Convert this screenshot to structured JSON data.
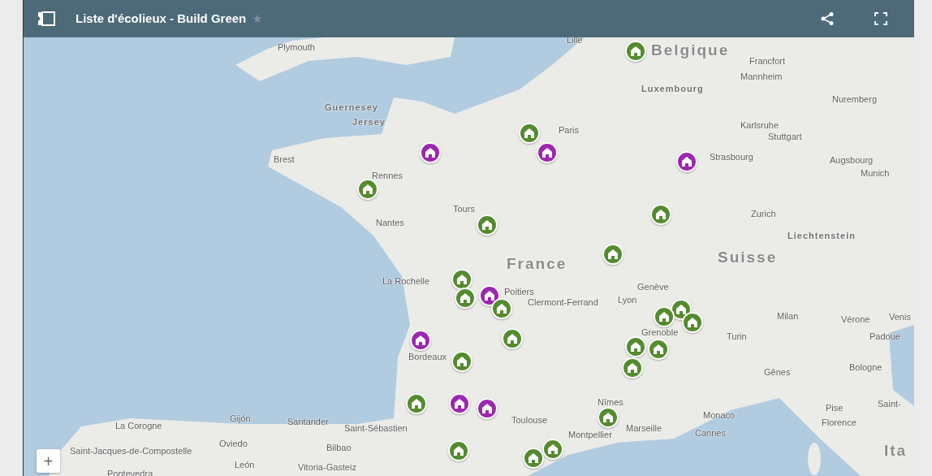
{
  "header": {
    "title": "Liste d'écolieux - Build Green",
    "starred": false
  },
  "map_labels": [
    {
      "text": "Plymouth",
      "kind": "city"
    },
    {
      "text": "Lille",
      "kind": "city"
    },
    {
      "text": "Belgique",
      "kind": "country"
    },
    {
      "text": "Francfort",
      "kind": "city"
    },
    {
      "text": "Luxembourg",
      "kind": "region"
    },
    {
      "text": "Mannheim",
      "kind": "city"
    },
    {
      "text": "Nuremberg",
      "kind": "city"
    },
    {
      "text": "Guernesey",
      "kind": "region"
    },
    {
      "text": "Jersey",
      "kind": "region"
    },
    {
      "text": "Karlsruhe",
      "kind": "city"
    },
    {
      "text": "Paris",
      "kind": "city"
    },
    {
      "text": "Stuttgart",
      "kind": "city"
    },
    {
      "text": "Brest",
      "kind": "city"
    },
    {
      "text": "Strasbourg",
      "kind": "city"
    },
    {
      "text": "Rennes",
      "kind": "city"
    },
    {
      "text": "Augsbourg",
      "kind": "city"
    },
    {
      "text": "Munich",
      "kind": "city"
    },
    {
      "text": "Nantes",
      "kind": "city"
    },
    {
      "text": "Tours",
      "kind": "city"
    },
    {
      "text": "Zurich",
      "kind": "city"
    },
    {
      "text": "Liechtenstein",
      "kind": "region"
    },
    {
      "text": "France",
      "kind": "country"
    },
    {
      "text": "Suisse",
      "kind": "country"
    },
    {
      "text": "La Rochelle",
      "kind": "city"
    },
    {
      "text": "Genève",
      "kind": "city"
    },
    {
      "text": "Poitiers",
      "kind": "city"
    },
    {
      "text": "Clermont-Ferrand",
      "kind": "city"
    },
    {
      "text": "Lyon",
      "kind": "city"
    },
    {
      "text": "Milan",
      "kind": "city"
    },
    {
      "text": "Vérone",
      "kind": "city"
    },
    {
      "text": "Venis",
      "kind": "city"
    },
    {
      "text": "Padoue",
      "kind": "city"
    },
    {
      "text": "Grenoble",
      "kind": "city"
    },
    {
      "text": "Turin",
      "kind": "city"
    },
    {
      "text": "Bordeaux",
      "kind": "city"
    },
    {
      "text": "Bologne",
      "kind": "city"
    },
    {
      "text": "Gênes",
      "kind": "city"
    },
    {
      "text": "Toulouse",
      "kind": "city"
    },
    {
      "text": "Nîmes",
      "kind": "city"
    },
    {
      "text": "Pise",
      "kind": "city"
    },
    {
      "text": "Saint-",
      "kind": "city"
    },
    {
      "text": "Monaco",
      "kind": "city"
    },
    {
      "text": "Montpellier",
      "kind": "city"
    },
    {
      "text": "Marseille",
      "kind": "city"
    },
    {
      "text": "Florence",
      "kind": "city"
    },
    {
      "text": "Cannes",
      "kind": "city"
    },
    {
      "text": "La Corogne",
      "kind": "city"
    },
    {
      "text": "Gijón",
      "kind": "city"
    },
    {
      "text": "Santander",
      "kind": "city"
    },
    {
      "text": "Saint-Sébastien",
      "kind": "city"
    },
    {
      "text": "Oviedo",
      "kind": "city"
    },
    {
      "text": "Bilbao",
      "kind": "city"
    },
    {
      "text": "Saint-Jacques-de-Compostelle",
      "kind": "city"
    },
    {
      "text": "Ita",
      "kind": "country"
    },
    {
      "text": "León",
      "kind": "city"
    },
    {
      "text": "Vitoria-Gasteiz",
      "kind": "city"
    },
    {
      "text": "Pontevedra",
      "kind": "city"
    }
  ],
  "markers": [
    {
      "color": "#558b2f"
    },
    {
      "color": "#558b2f"
    },
    {
      "color": "#9c27b0"
    },
    {
      "color": "#9c27b0"
    },
    {
      "color": "#9c27b0"
    },
    {
      "color": "#558b2f"
    },
    {
      "color": "#558b2f"
    },
    {
      "color": "#558b2f"
    },
    {
      "color": "#558b2f"
    },
    {
      "color": "#558b2f"
    },
    {
      "color": "#9c27b0"
    },
    {
      "color": "#558b2f"
    },
    {
      "color": "#558b2f"
    },
    {
      "color": "#558b2f"
    },
    {
      "color": "#558b2f"
    },
    {
      "color": "#558b2f"
    },
    {
      "color": "#558b2f"
    },
    {
      "color": "#9c27b0"
    },
    {
      "color": "#558b2f"
    },
    {
      "color": "#558b2f"
    },
    {
      "color": "#558b2f"
    },
    {
      "color": "#558b2f"
    },
    {
      "color": "#558b2f"
    },
    {
      "color": "#9c27b0"
    },
    {
      "color": "#9c27b0"
    },
    {
      "color": "#558b2f"
    },
    {
      "color": "#558b2f"
    },
    {
      "color": "#558b2f"
    },
    {
      "color": "#558b2f"
    }
  ],
  "zoom_control": {
    "label": "+"
  }
}
